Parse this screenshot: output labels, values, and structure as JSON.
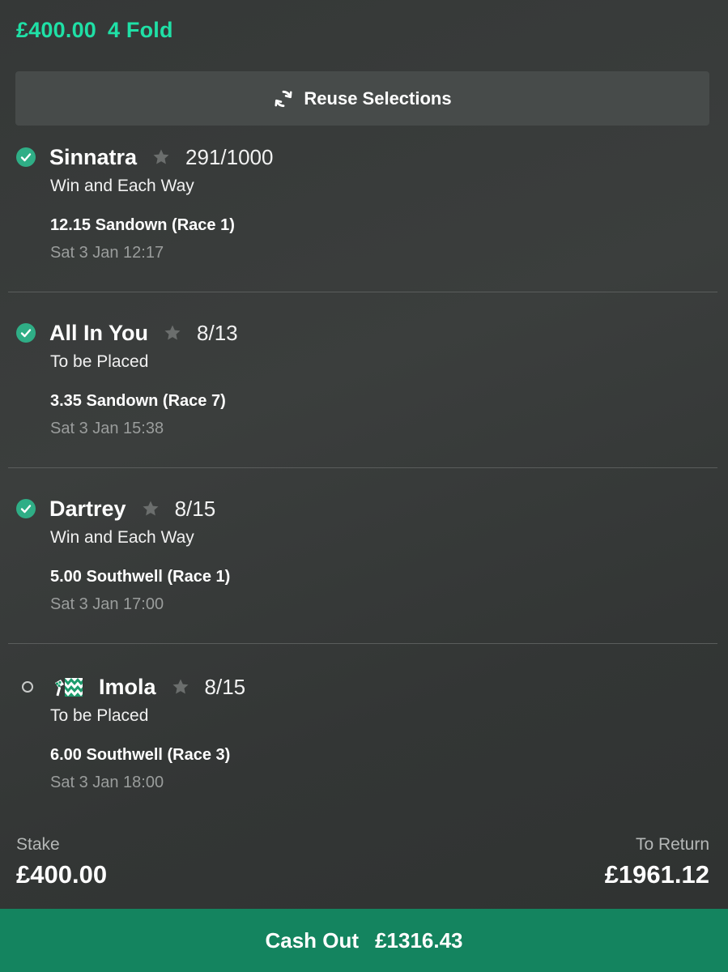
{
  "header": {
    "stake": "£400.00",
    "bet_type": "4 Fold",
    "accent_color": "#1fe0a6"
  },
  "reuse": {
    "label": "Reuse Selections",
    "icon": "refresh-icon"
  },
  "selections": [
    {
      "name": "Sinnatra",
      "odds": "291/1000",
      "market": "Win and Each Way",
      "event": "12.15 Sandown (Race 1)",
      "time": "Sat 3 Jan 12:17",
      "status": "won"
    },
    {
      "name": "All In You",
      "odds": "8/13",
      "market": "To be Placed",
      "event": "3.35 Sandown (Race 7)",
      "time": "Sat 3 Jan 15:38",
      "status": "won"
    },
    {
      "name": "Dartrey",
      "odds": "8/15",
      "market": "Win and Each Way",
      "event": "5.00 Southwell (Race 1)",
      "time": "Sat 3 Jan 17:00",
      "status": "won"
    },
    {
      "name": "Imola",
      "odds": "8/15",
      "market": "To be Placed",
      "event": "6.00 Southwell (Race 3)",
      "time": "Sat 3 Jan 18:00",
      "status": "pending"
    }
  ],
  "summary": {
    "stake_label": "Stake",
    "stake_value": "£400.00",
    "return_label": "To Return",
    "return_value": "£1961.12"
  },
  "cashout": {
    "label": "Cash Out",
    "amount": "£1316.43",
    "color": "#14845f"
  }
}
